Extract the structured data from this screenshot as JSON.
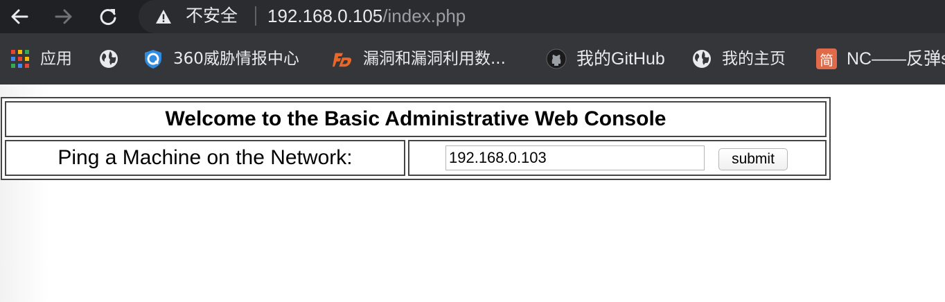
{
  "browser": {
    "security_label": "不安全",
    "url_host": "192.168.0.105",
    "url_path": "/index.php",
    "icons": {
      "back": "arrow-left-icon",
      "forward": "arrow-right-icon",
      "reload": "reload-icon",
      "security": "warning-triangle-icon"
    },
    "colors": {
      "toolbar_bg": "#202124",
      "omnibox_bg": "#2b2c2f",
      "bookmarks_bg": "#35363a",
      "text": "#e8eaed"
    }
  },
  "bookmarks": [
    {
      "label": "应用",
      "icon": "apps-grid-icon"
    },
    {
      "label": "",
      "icon": "globe-icon"
    },
    {
      "label": "360威胁情报中心",
      "icon": "shield-q-icon"
    },
    {
      "label": "漏洞和漏洞利用数...",
      "icon": "fd-logo-icon"
    },
    {
      "label": "我的GitHub",
      "icon": "github-icon"
    },
    {
      "label": "我的主页",
      "icon": "globe-icon"
    },
    {
      "label": "NC——反弹s",
      "icon": "jian-badge-icon",
      "icon_text": "简"
    }
  ],
  "page": {
    "title": "Welcome to the Basic Administrative Web Console",
    "ping_label": "Ping a Machine on the Network:",
    "ip_input_value": "192.168.0.103",
    "submit_label": "submit"
  }
}
